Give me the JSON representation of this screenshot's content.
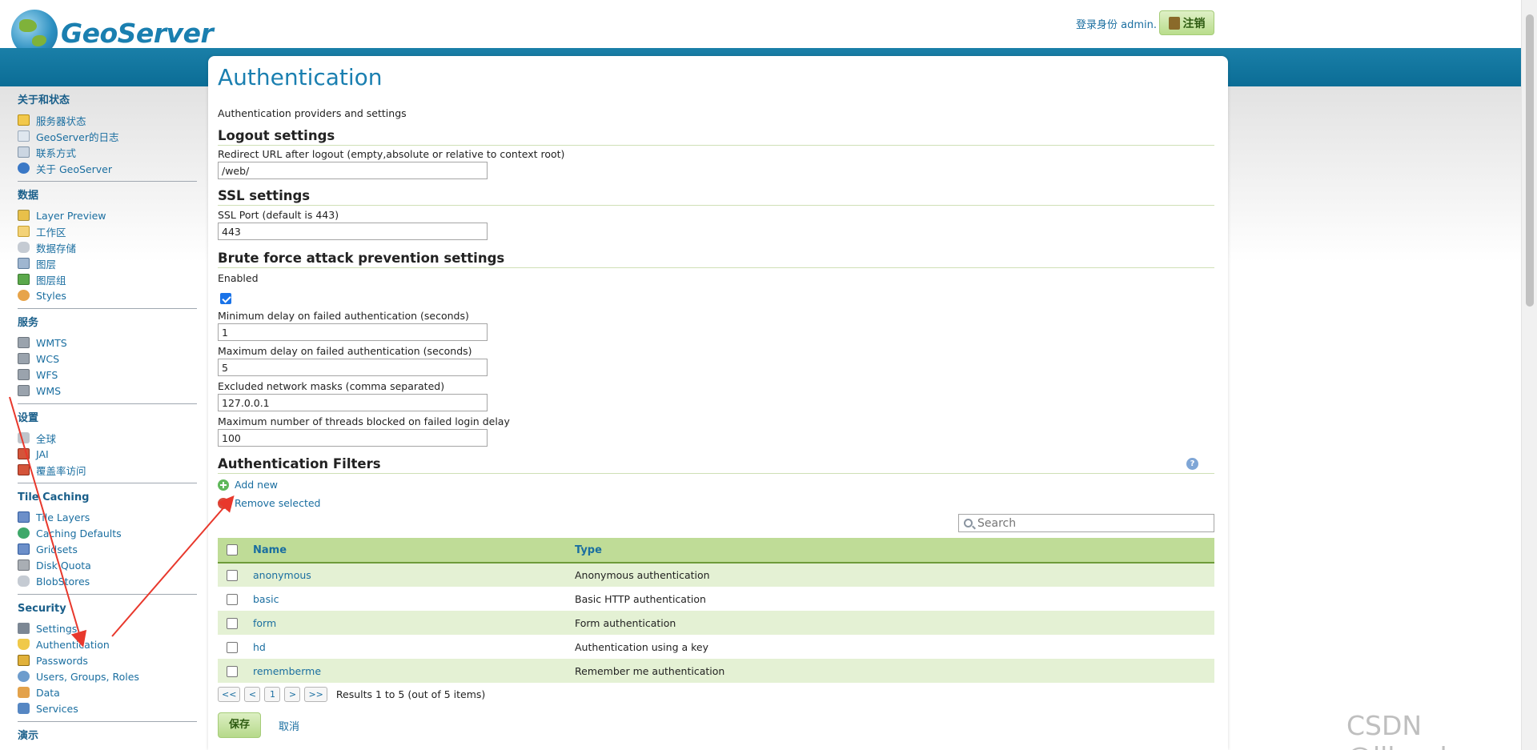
{
  "header": {
    "logo_text": "GeoServer",
    "login_info": "登录身份 admin.",
    "logout_label": "注销"
  },
  "sidebar": {
    "sections": [
      {
        "title": "关于和状态",
        "items": [
          {
            "label": "服务器状态",
            "icon": "warning-icon"
          },
          {
            "label": "GeoServer的日志",
            "icon": "document-icon"
          },
          {
            "label": "联系方式",
            "icon": "contact-card-icon"
          },
          {
            "label": "关于 GeoServer",
            "icon": "info-icon"
          }
        ]
      },
      {
        "title": "数据",
        "items": [
          {
            "label": "Layer Preview",
            "icon": "map-icon"
          },
          {
            "label": "工作区",
            "icon": "folder-icon"
          },
          {
            "label": "数据存储",
            "icon": "database-icon"
          },
          {
            "label": "图层",
            "icon": "layer-icon"
          },
          {
            "label": "图层组",
            "icon": "layer-group-icon"
          },
          {
            "label": "Styles",
            "icon": "palette-icon"
          }
        ]
      },
      {
        "title": "服务",
        "items": [
          {
            "label": "WMTS",
            "icon": "server-icon"
          },
          {
            "label": "WCS",
            "icon": "server-icon"
          },
          {
            "label": "WFS",
            "icon": "server-icon"
          },
          {
            "label": "WMS",
            "icon": "server-icon"
          }
        ]
      },
      {
        "title": "设置",
        "items": [
          {
            "label": "全球",
            "icon": "global-settings-icon"
          },
          {
            "label": "JAI",
            "icon": "jai-icon"
          },
          {
            "label": "覆盖率访问",
            "icon": "coverage-icon"
          }
        ]
      },
      {
        "title": "Tile Caching",
        "items": [
          {
            "label": "Tile Layers",
            "icon": "grid-icon"
          },
          {
            "label": "Caching Defaults",
            "icon": "globe-icon"
          },
          {
            "label": "Gridsets",
            "icon": "grid-icon"
          },
          {
            "label": "Disk Quota",
            "icon": "disk-icon"
          },
          {
            "label": "BlobStores",
            "icon": "database-icon"
          }
        ]
      },
      {
        "title": "Security",
        "items": [
          {
            "label": "Settings",
            "icon": "wrench-icon"
          },
          {
            "label": "Authentication",
            "icon": "shield-icon"
          },
          {
            "label": "Passwords",
            "icon": "lock-icon"
          },
          {
            "label": "Users, Groups, Roles",
            "icon": "users-icon"
          },
          {
            "label": "Data",
            "icon": "data-icon"
          },
          {
            "label": "Services",
            "icon": "services-icon"
          }
        ]
      },
      {
        "title": "演示",
        "items": []
      }
    ]
  },
  "main": {
    "title": "Authentication",
    "description": "Authentication providers and settings",
    "logout_settings": {
      "title": "Logout settings",
      "redirect_label": "Redirect URL after logout (empty,absolute or relative to context root)",
      "redirect_value": "/web/"
    },
    "ssl_settings": {
      "title": "SSL settings",
      "port_label": "SSL Port (default is 443)",
      "port_value": "443"
    },
    "brute_force": {
      "title": "Brute force attack prevention settings",
      "enabled_label": "Enabled",
      "enabled": true,
      "min_delay_label": "Minimum delay on failed authentication (seconds)",
      "min_delay_value": "1",
      "max_delay_label": "Maximum delay on failed authentication (seconds)",
      "max_delay_value": "5",
      "excluded_label": "Excluded network masks (comma separated)",
      "excluded_value": "127.0.0.1",
      "max_threads_label": "Maximum number of threads blocked on failed login delay",
      "max_threads_value": "100"
    },
    "filters": {
      "title": "Authentication Filters",
      "add_new": "Add new",
      "remove_selected": "Remove selected",
      "search_placeholder": "Search",
      "columns": [
        "Name",
        "Type"
      ],
      "rows": [
        {
          "name": "anonymous",
          "type": "Anonymous authentication"
        },
        {
          "name": "basic",
          "type": "Basic HTTP authentication"
        },
        {
          "name": "form",
          "type": "Form authentication"
        },
        {
          "name": "hd",
          "type": "Authentication using a key"
        },
        {
          "name": "rememberme",
          "type": "Remember me authentication"
        }
      ],
      "pager": {
        "first": "<<",
        "prev": "<",
        "page": "1",
        "next": ">",
        "last": ">>",
        "info": "Results 1 to 5 (out of 5 items)"
      }
    },
    "save_label": "保存",
    "cancel_label": "取消"
  },
  "watermark": "CSDN @llbzwb",
  "colors": {
    "accent": "#1a7fb0",
    "banner": "#0b6d96",
    "table_header": "#bfdc97",
    "table_row_alt": "#e4f1d4",
    "annotation_arrow": "#e8382c"
  }
}
